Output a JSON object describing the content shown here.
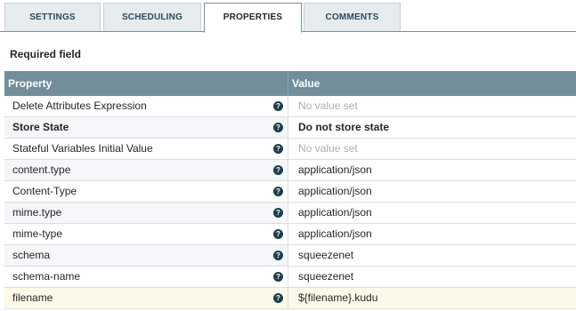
{
  "tabs": [
    {
      "label": "SETTINGS"
    },
    {
      "label": "SCHEDULING"
    },
    {
      "label": "PROPERTIES"
    },
    {
      "label": "COMMENTS"
    }
  ],
  "active_tab": "PROPERTIES",
  "required_label": "Required field",
  "table": {
    "headers": {
      "property": "Property",
      "value": "Value"
    },
    "rows": [
      {
        "name": "Delete Attributes Expression",
        "value": "No value set"
      },
      {
        "name": "Store State",
        "value": "Do not store state"
      },
      {
        "name": "Stateful Variables Initial Value",
        "value": "No value set"
      },
      {
        "name": "content.type",
        "value": "application/json"
      },
      {
        "name": "Content-Type",
        "value": "application/json"
      },
      {
        "name": "mime.type",
        "value": "application/json"
      },
      {
        "name": "mime-type",
        "value": "application/json"
      },
      {
        "name": "schema",
        "value": "squeezenet"
      },
      {
        "name": "schema-name",
        "value": "squeezenet"
      },
      {
        "name": "filename",
        "value": "${filename}.kudu"
      }
    ]
  },
  "icons": {
    "help": "question-circle-icon"
  },
  "colors": {
    "header_bg": "#728e9b",
    "help_icon": "#1f3f4d",
    "highlight_row": "#fdf9e8",
    "placeholder_text": "#a8b0b4"
  }
}
